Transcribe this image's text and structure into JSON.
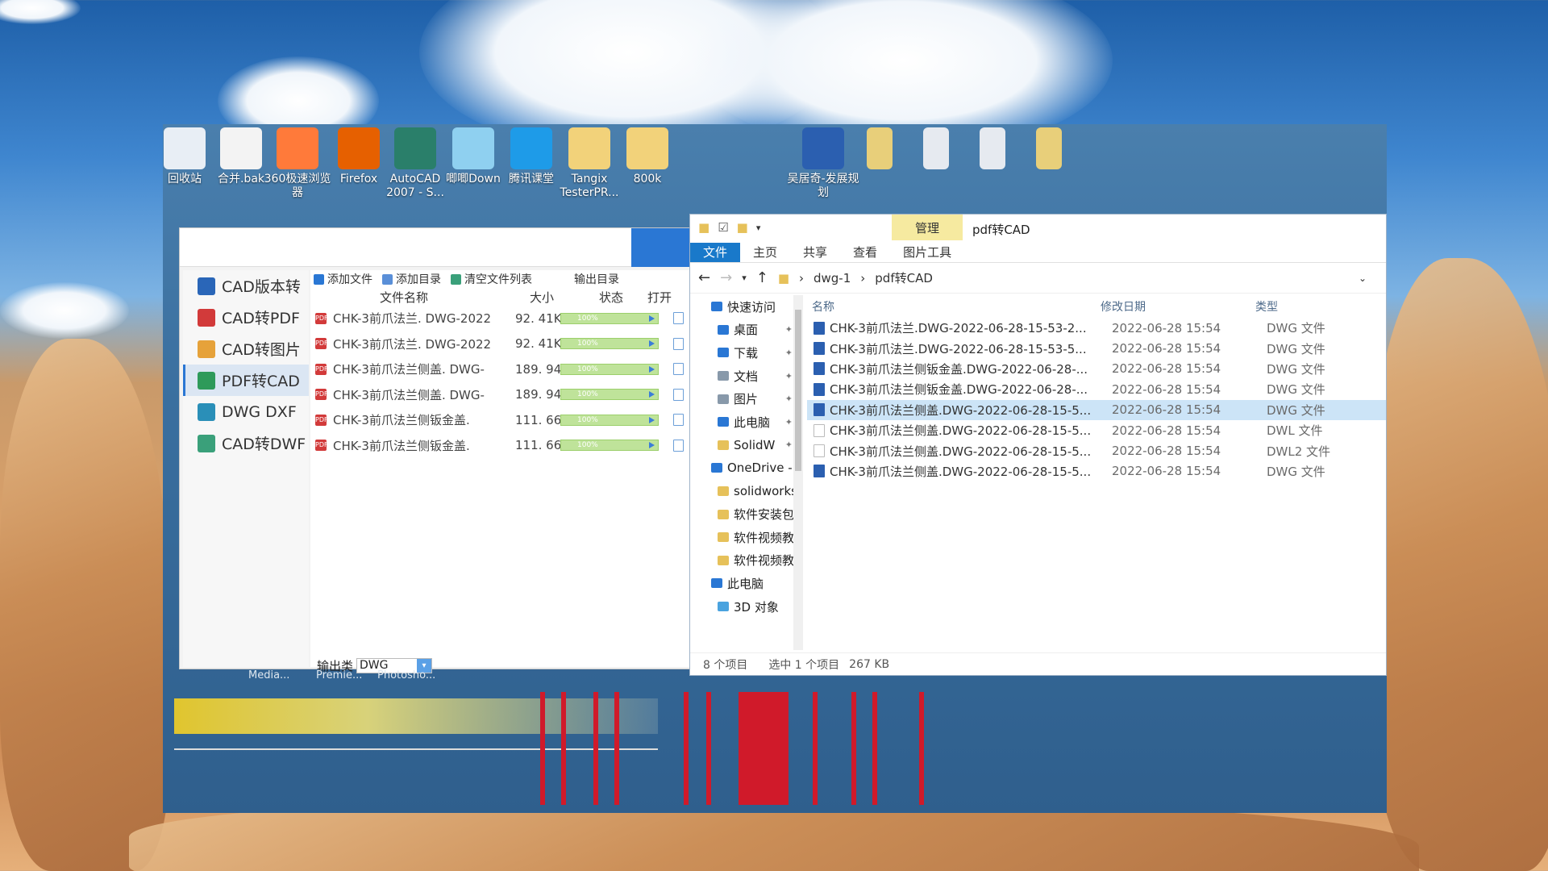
{
  "desktop": {
    "icons": [
      {
        "label": "回收站",
        "icon": "recycle-bin-icon",
        "color": "#e8eef5"
      },
      {
        "label": "合并.bak",
        "icon": "file-icon",
        "color": "#f3f3f3"
      },
      {
        "label": "360极速浏览器",
        "icon": "browser-360-icon",
        "color": "#ff7a3a"
      },
      {
        "label": "Firefox",
        "icon": "firefox-icon",
        "color": "#e66000"
      },
      {
        "label": "AutoCAD 2007 - S...",
        "icon": "autocad-icon",
        "color": "#2a7f6a"
      },
      {
        "label": "唧唧Down",
        "icon": "jijidown-icon",
        "color": "#8fd0f0"
      },
      {
        "label": "腾讯课堂",
        "icon": "tencent-classroom-icon",
        "color": "#1e9be8"
      },
      {
        "label": "Tangix TesterPR...",
        "icon": "folder-icon",
        "color": "#f2d27a"
      },
      {
        "label": "800k",
        "icon": "folder-icon",
        "color": "#f2d27a"
      },
      {
        "label": "吴居奇-发展规划",
        "icon": "word-doc-icon",
        "color": "#2b5fb0"
      }
    ]
  },
  "converter": {
    "sidebar": [
      {
        "label": "CAD版本转",
        "color": "#2a66b8"
      },
      {
        "label": "CAD转PDF",
        "color": "#d23a3a"
      },
      {
        "label": "CAD转图片",
        "color": "#e6a23a"
      },
      {
        "label": "PDF转CAD",
        "color": "#2e9a5a"
      },
      {
        "label": "DWG DXF",
        "color": "#2a8fb8"
      },
      {
        "label": "CAD转DWF",
        "color": "#3aa07a"
      }
    ],
    "toolbar": {
      "add_file": "添加文件",
      "add_dir": "添加目录",
      "clear_list": "清空文件列表",
      "output_dir": "输出目录"
    },
    "columns": {
      "name": "文件名称",
      "size": "大小",
      "status": "状态",
      "open": "打开"
    },
    "files": [
      {
        "name": "CHK-3前爪法兰. DWG-2022",
        "size": "92. 41KB",
        "progress": "100%"
      },
      {
        "name": "CHK-3前爪法兰. DWG-2022",
        "size": "92. 41KB",
        "progress": "100%"
      },
      {
        "name": "CHK-3前爪法兰侧盖. DWG-",
        "size": "189. 94KB",
        "progress": "100%"
      },
      {
        "name": "CHK-3前爪法兰侧盖. DWG-",
        "size": "189. 94KB",
        "progress": "100%"
      },
      {
        "name": "CHK-3前爪法兰侧钣金盖.",
        "size": "111. 66KB",
        "progress": "100%"
      },
      {
        "name": "CHK-3前爪法兰侧钣金盖.",
        "size": "111. 66KB",
        "progress": "100%"
      }
    ],
    "output_type_label": "输出类",
    "output_type_value": "DWG"
  },
  "explorer": {
    "title": "pdf转CAD",
    "manage_tab": "管理",
    "ribbon_tabs": [
      "文件",
      "主页",
      "共享",
      "查看",
      "图片工具"
    ],
    "breadcrumb": [
      "dwg-1",
      "pdf转CAD"
    ],
    "nav": [
      {
        "label": "快速访问",
        "type": "section",
        "color": "#2a77d4",
        "pinned": false
      },
      {
        "label": "桌面",
        "type": "item",
        "color": "#2a77d4",
        "pinned": true
      },
      {
        "label": "下载",
        "type": "item",
        "color": "#2a77d4",
        "pinned": true
      },
      {
        "label": "文档",
        "type": "item",
        "color": "#8899aa",
        "pinned": true
      },
      {
        "label": "图片",
        "type": "item",
        "color": "#8899aa",
        "pinned": true
      },
      {
        "label": "此电脑",
        "type": "item",
        "color": "#2a77d4",
        "pinned": true
      },
      {
        "label": "SolidW",
        "type": "item",
        "color": "#e6c15a",
        "pinned": true
      },
      {
        "label": "OneDrive -",
        "type": "section",
        "color": "#2a77d4",
        "pinned": false
      },
      {
        "label": "solidworks",
        "type": "item",
        "color": "#e6c15a",
        "pinned": false
      },
      {
        "label": "软件安装包",
        "type": "item",
        "color": "#e6c15a",
        "pinned": false
      },
      {
        "label": "软件视频教",
        "type": "item",
        "color": "#e6c15a",
        "pinned": false
      },
      {
        "label": "软件视频教",
        "type": "item",
        "color": "#e6c15a",
        "pinned": false
      },
      {
        "label": "此电脑",
        "type": "section",
        "color": "#2a77d4",
        "pinned": false
      },
      {
        "label": "3D 对象",
        "type": "item",
        "color": "#4aa3df",
        "pinned": false
      }
    ],
    "columns": {
      "name": "名称",
      "date": "修改日期",
      "type": "类型"
    },
    "files": [
      {
        "name": "CHK-3前爪法兰.DWG-2022-06-28-15-53-2...",
        "date": "2022-06-28 15:54",
        "type": "DWG 文件",
        "icon_color": "#2b5fb0",
        "selected": false
      },
      {
        "name": "CHK-3前爪法兰.DWG-2022-06-28-15-53-5...",
        "date": "2022-06-28 15:54",
        "type": "DWG 文件",
        "icon_color": "#2b5fb0",
        "selected": false
      },
      {
        "name": "CHK-3前爪法兰侧钣金盖.DWG-2022-06-28-...",
        "date": "2022-06-28 15:54",
        "type": "DWG 文件",
        "icon_color": "#2b5fb0",
        "selected": false
      },
      {
        "name": "CHK-3前爪法兰侧钣金盖.DWG-2022-06-28-...",
        "date": "2022-06-28 15:54",
        "type": "DWG 文件",
        "icon_color": "#2b5fb0",
        "selected": false
      },
      {
        "name": "CHK-3前爪法兰侧盖.DWG-2022-06-28-15-5...",
        "date": "2022-06-28 15:54",
        "type": "DWG 文件",
        "icon_color": "#2b5fb0",
        "selected": true
      },
      {
        "name": "CHK-3前爪法兰侧盖.DWG-2022-06-28-15-5...",
        "date": "2022-06-28 15:54",
        "type": "DWL 文件",
        "icon_color": "#ffffff",
        "selected": false
      },
      {
        "name": "CHK-3前爪法兰侧盖.DWG-2022-06-28-15-5...",
        "date": "2022-06-28 15:54",
        "type": "DWL2 文件",
        "icon_color": "#ffffff",
        "selected": false
      },
      {
        "name": "CHK-3前爪法兰侧盖.DWG-2022-06-28-15-5...",
        "date": "2022-06-28 15:54",
        "type": "DWG 文件",
        "icon_color": "#2b5fb0",
        "selected": false
      }
    ],
    "status": {
      "count": "8 个项目",
      "selection": "选中 1 个项目",
      "size": "267 KB"
    }
  },
  "taskbar_ghosts": [
    "Media...",
    "Premie...",
    "Photosho..."
  ]
}
